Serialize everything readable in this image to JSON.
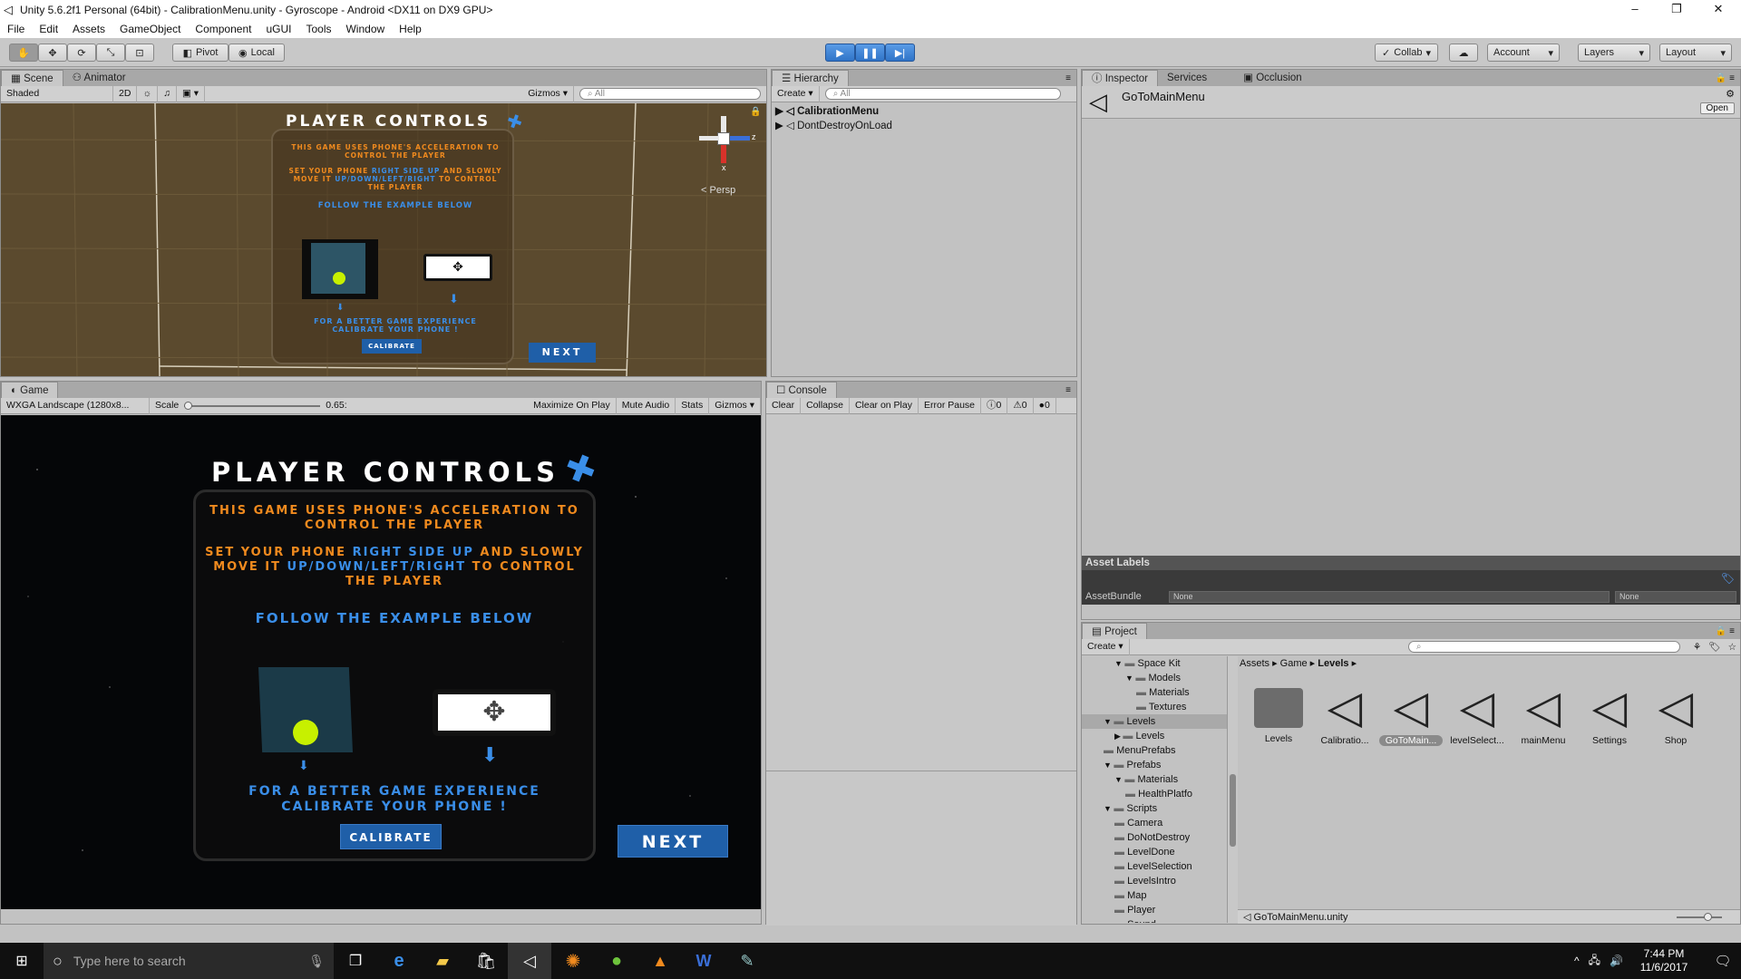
{
  "window": {
    "title": "Unity 5.6.2f1 Personal (64bit) - CalibrationMenu.unity - Gyroscope - Android <DX11 on DX9 GPU>",
    "controls": [
      "–",
      "❐",
      "✕"
    ]
  },
  "menu": [
    "File",
    "Edit",
    "Assets",
    "GameObject",
    "Component",
    "uGUI",
    "Tools",
    "Window",
    "Help"
  ],
  "toolbar": {
    "pivot": "Pivot",
    "local": "Local",
    "collab": "Collab",
    "account": "Account",
    "layers": "Layers",
    "layout": "Layout"
  },
  "scene": {
    "tab_scene": "Scene",
    "tab_animator": "Animator",
    "shading": "Shaded",
    "mode_2d": "2D",
    "gizmos": "Gizmos",
    "search_placeholder": "All",
    "persp": "Persp",
    "axis_x": "x",
    "axis_z": "z"
  },
  "game": {
    "tab": "Game",
    "resolution": "WXGA Landscape (1280x8...",
    "scale_label": "Scale",
    "scale_value": "0.65:",
    "maximize": "Maximize On Play",
    "mute": "Mute Audio",
    "stats": "Stats",
    "gizmos": "Gizmos"
  },
  "ui_screen": {
    "title": "PLAYER CONTROLS",
    "line1": "THIS GAME USES PHONE'S ACCELERATION TO",
    "line1b": "CONTROL THE PLAYER",
    "line2a": "SET YOUR PHONE ",
    "line2b": "RIGHT SIDE UP",
    "line2c": " AND SLOWLY",
    "line3a": "MOVE IT ",
    "line3b": "UP/DOWN/LEFT/RIGHT",
    "line3c": " TO CONTROL",
    "line4": "THE PLAYER",
    "follow": "FOLLOW THE EXAMPLE BELOW",
    "better1": "FOR A BETTER GAME EXPERIENCE",
    "better2": "CALIBRATE YOUR PHONE !",
    "calibrate": "CALIBRATE",
    "next": "NEXT"
  },
  "hierarchy": {
    "tab": "Hierarchy",
    "create": "Create",
    "search_placeholder": "All",
    "items": [
      "CalibrationMenu",
      "DontDestroyOnLoad"
    ]
  },
  "console": {
    "tab": "Console",
    "clear": "Clear",
    "collapse": "Collapse",
    "clear_on_play": "Clear on Play",
    "error_pause": "Error Pause",
    "count_info": "0",
    "count_warn": "0",
    "count_err": "0"
  },
  "inspector": {
    "tabs": [
      "Inspector",
      "Services",
      "Occlusion"
    ],
    "object_name": "GoToMainMenu",
    "open": "Open",
    "asset_labels": "Asset Labels",
    "assetbundle_label": "AssetBundle",
    "assetbundle_value": "None",
    "variant_value": "None"
  },
  "project": {
    "tab": "Project",
    "create": "Create",
    "breadcrumb": [
      "Assets",
      "Game",
      "Levels"
    ],
    "tree": [
      {
        "label": "Space Kit",
        "indent": 3,
        "arrow": "▼"
      },
      {
        "label": "Models",
        "indent": 4,
        "arrow": "▼"
      },
      {
        "label": "Materials",
        "indent": 5,
        "arrow": ""
      },
      {
        "label": "Textures",
        "indent": 5,
        "arrow": ""
      },
      {
        "label": "Levels",
        "indent": 2,
        "arrow": "▼"
      },
      {
        "label": "Levels",
        "indent": 3,
        "arrow": "▶"
      },
      {
        "label": "MenuPrefabs",
        "indent": 2,
        "arrow": ""
      },
      {
        "label": "Prefabs",
        "indent": 2,
        "arrow": "▼"
      },
      {
        "label": "Materials",
        "indent": 3,
        "arrow": "▼"
      },
      {
        "label": "HealthPlatfo",
        "indent": 4,
        "arrow": ""
      },
      {
        "label": "Scripts",
        "indent": 2,
        "arrow": "▼"
      },
      {
        "label": "Camera",
        "indent": 3,
        "arrow": ""
      },
      {
        "label": "DoNotDestroy",
        "indent": 3,
        "arrow": ""
      },
      {
        "label": "LevelDone",
        "indent": 3,
        "arrow": ""
      },
      {
        "label": "LevelSelection",
        "indent": 3,
        "arrow": ""
      },
      {
        "label": "LevelsIntro",
        "indent": 3,
        "arrow": ""
      },
      {
        "label": "Map",
        "indent": 3,
        "arrow": ""
      },
      {
        "label": "Player",
        "indent": 3,
        "arrow": ""
      },
      {
        "label": "Sound",
        "indent": 3,
        "arrow": ""
      }
    ],
    "assets": [
      "Levels",
      "Calibratio...",
      "GoToMain...",
      "levelSelect...",
      "mainMenu",
      "Settings",
      "Shop"
    ],
    "selected_file": "GoToMainMenu.unity"
  },
  "taskbar": {
    "search_placeholder": "Type here to search",
    "time": "7:44 PM",
    "date": "11/6/2017"
  }
}
